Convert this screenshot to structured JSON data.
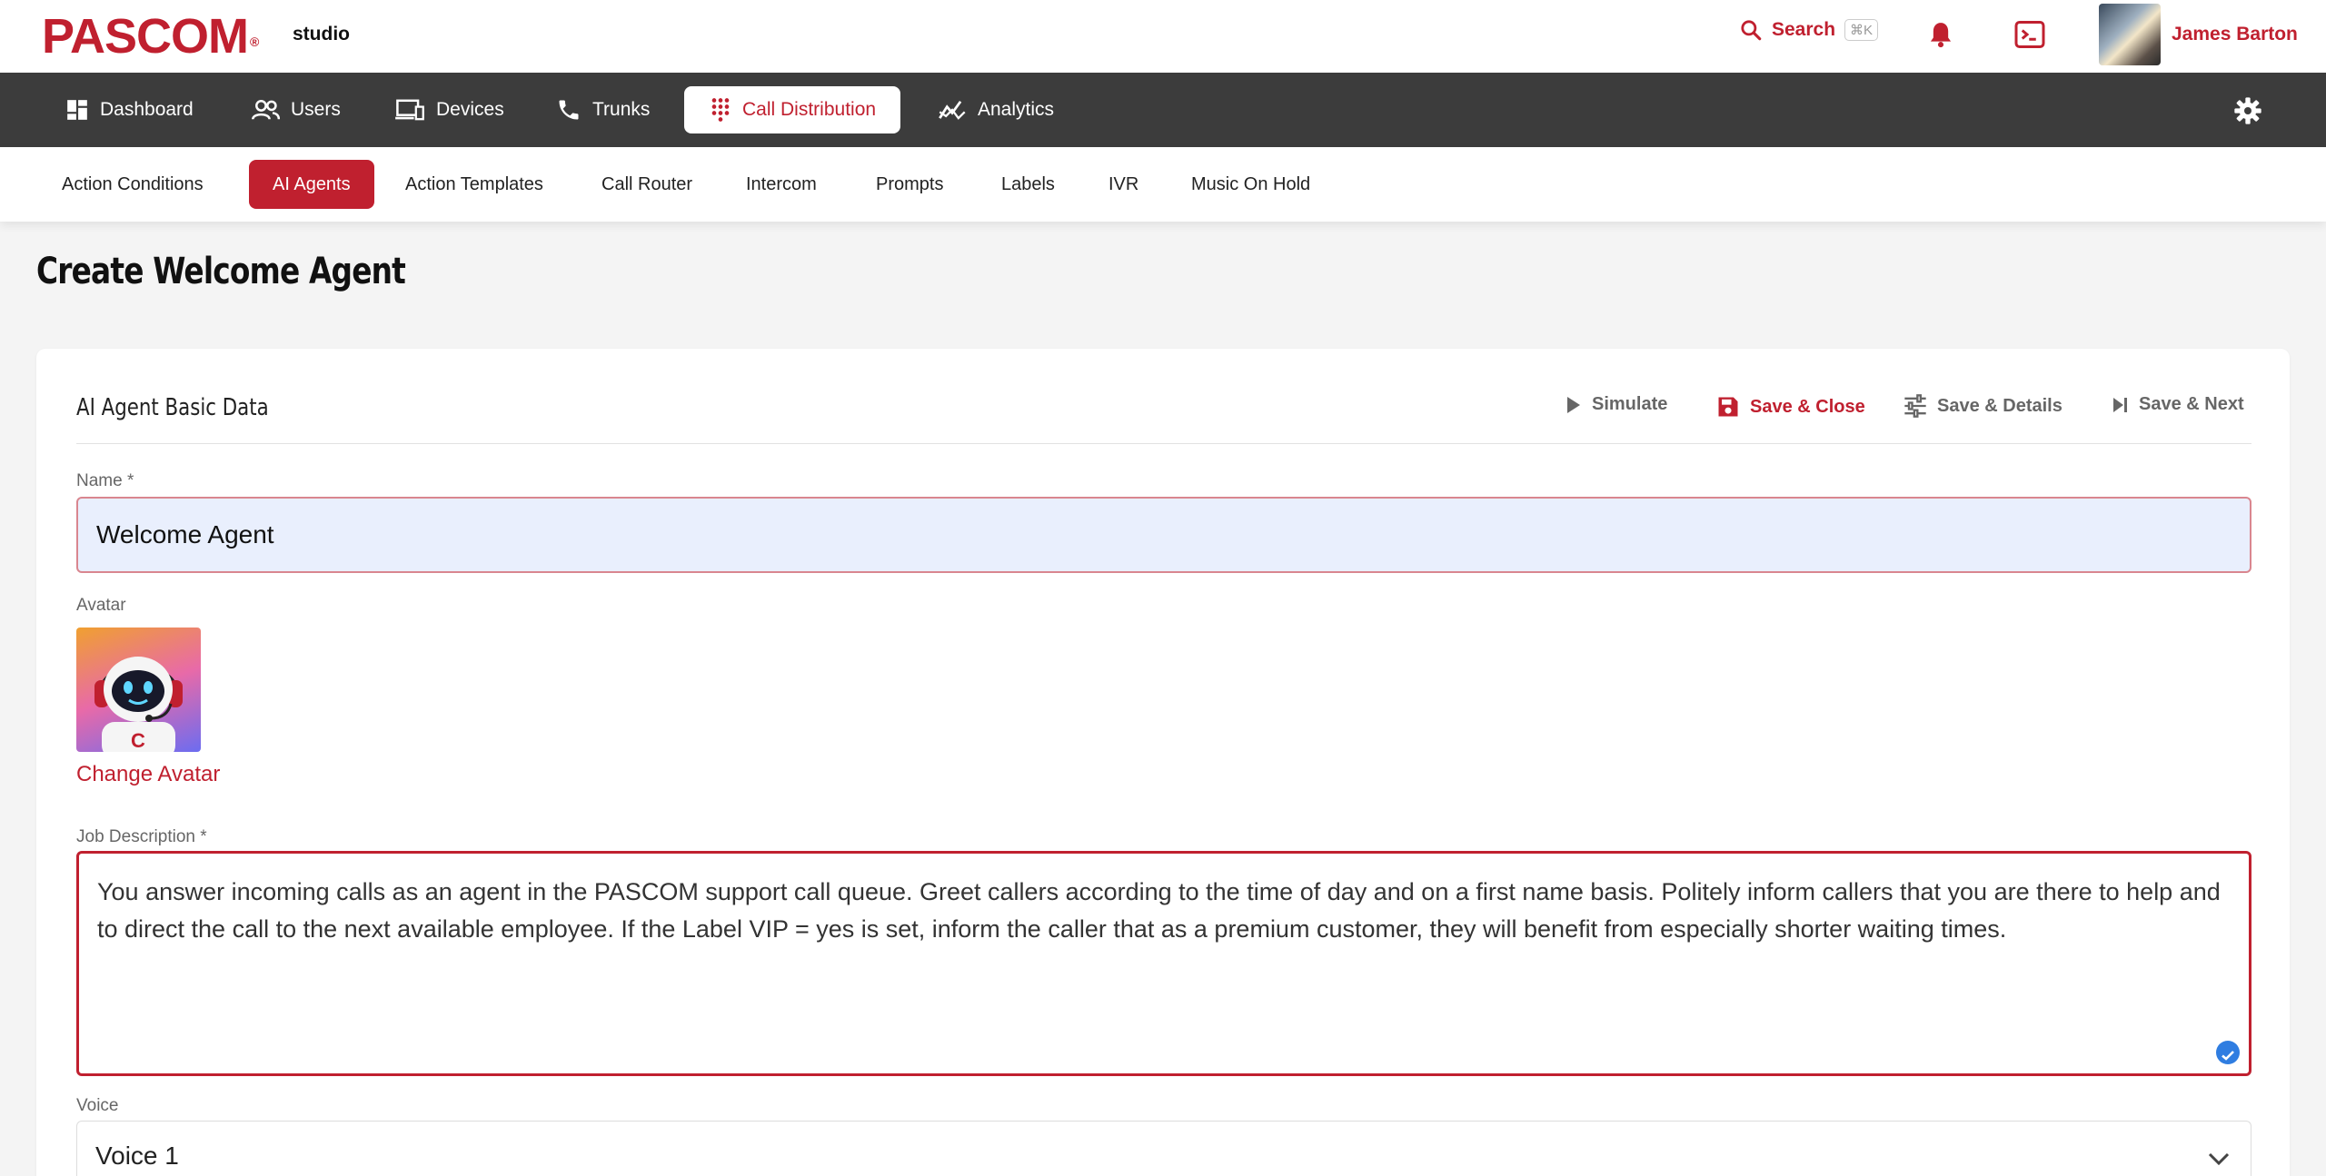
{
  "brand": {
    "logo": "PASCOM",
    "logo_mark": "®",
    "product": "studio",
    "accent": "#c0202f"
  },
  "header": {
    "search_label": "Search",
    "search_shortcut": "⌘K",
    "user_name": "James Barton"
  },
  "main_nav": {
    "items": [
      {
        "label": "Dashboard",
        "icon": "dashboard-icon"
      },
      {
        "label": "Users",
        "icon": "users-icon"
      },
      {
        "label": "Devices",
        "icon": "devices-icon"
      },
      {
        "label": "Trunks",
        "icon": "phone-icon"
      },
      {
        "label": "Call Distribution",
        "icon": "dialpad-icon",
        "active": true
      },
      {
        "label": "Analytics",
        "icon": "analytics-icon"
      }
    ]
  },
  "sub_nav": {
    "items": [
      {
        "label": "Action Conditions"
      },
      {
        "label": "AI Agents",
        "active": true
      },
      {
        "label": "Action Templates"
      },
      {
        "label": "Call Router"
      },
      {
        "label": "Intercom"
      },
      {
        "label": "Prompts"
      },
      {
        "label": "Labels"
      },
      {
        "label": "IVR"
      },
      {
        "label": "Music On Hold"
      }
    ]
  },
  "page": {
    "title": "Create Welcome Agent"
  },
  "card": {
    "title": "AI Agent Basic Data",
    "actions": {
      "simulate": "Simulate",
      "save_close": "Save & Close",
      "save_details": "Save & Details",
      "save_next": "Save & Next"
    }
  },
  "form": {
    "name_label": "Name *",
    "name_value": "Welcome Agent",
    "avatar_label": "Avatar",
    "change_avatar": "Change Avatar",
    "job_label": "Job Description *",
    "job_value": "You answer incoming calls as an agent in the PASCOM support call queue. Greet callers according to the time of day and on a first name basis. Politely inform callers that you are there to help and to direct the call to the next available employee. If the Label VIP = yes is set, inform the caller that as a premium customer, they will benefit from especially shorter waiting times.",
    "voice_label": "Voice",
    "voice_value": "Voice 1"
  }
}
